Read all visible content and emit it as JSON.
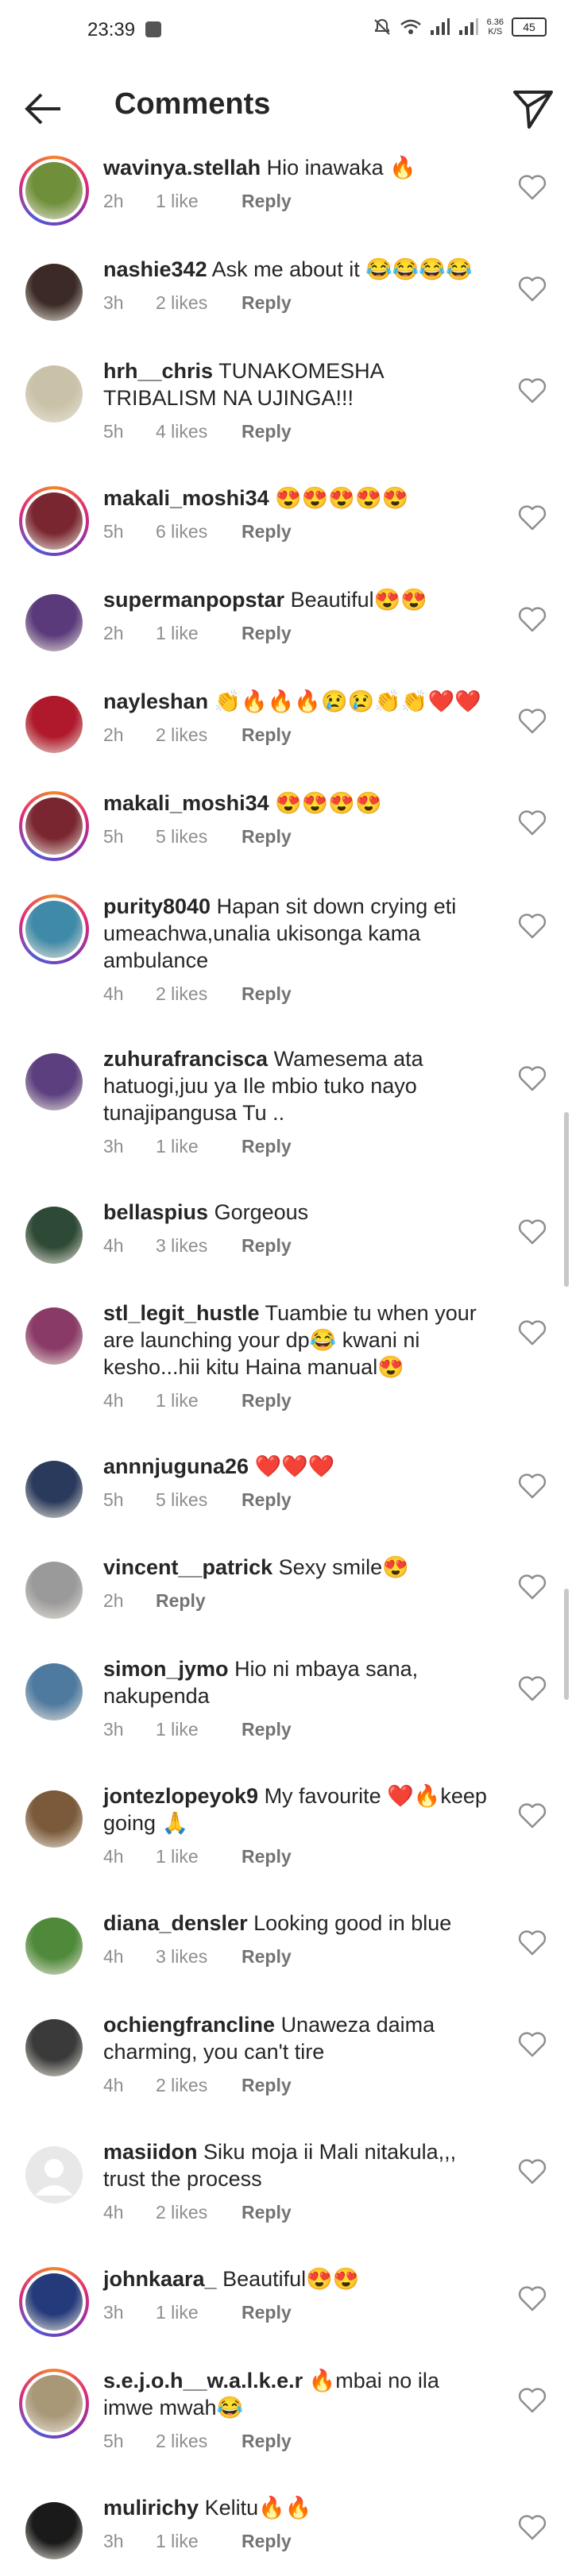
{
  "status": {
    "time": "23:39",
    "speed_top": "6.36",
    "speed_bottom": "K/S",
    "battery": "45"
  },
  "header": {
    "title": "Comments"
  },
  "colors": {
    "text": "#262626",
    "meta": "#8e8e8e",
    "accent_ring": "#dd2a7b"
  },
  "comments": [
    {
      "username": "wavinya.stellah",
      "text": "Hio inawaka 🔥",
      "age": "2h",
      "likes": "1 like",
      "reply": "Reply"
    },
    {
      "username": "nashie342",
      "text": "Ask me about it 😂😂😂😂",
      "age": "3h",
      "likes": "2 likes",
      "reply": "Reply"
    },
    {
      "username": "hrh__chris",
      "text": "TUNAKOMESHA TRIBALISM NA UJINGA!!!",
      "age": "5h",
      "likes": "4 likes",
      "reply": "Reply"
    },
    {
      "username": "makali_moshi34",
      "text": "😍😍😍😍😍",
      "age": "5h",
      "likes": "6 likes",
      "reply": "Reply"
    },
    {
      "username": "supermanpopstar",
      "text": "Beautiful😍😍",
      "age": "2h",
      "likes": "1 like",
      "reply": "Reply"
    },
    {
      "username": "nayleshan",
      "text": "👏🔥🔥🔥😢😢👏👏❤️❤️",
      "age": "2h",
      "likes": "2 likes",
      "reply": "Reply"
    },
    {
      "username": "makali_moshi34",
      "text": "😍😍😍😍",
      "age": "5h",
      "likes": "5 likes",
      "reply": "Reply"
    },
    {
      "username": "purity8040",
      "text": "Hapan sit down crying eti umeachwa,unalia ukisonga kama ambulance",
      "age": "4h",
      "likes": "2 likes",
      "reply": "Reply"
    },
    {
      "username": "zuhurafrancisca",
      "text": "Wamesema ata hatuogi,juu ya Ile mbio tuko nayo tunajipangusa Tu ..",
      "age": "3h",
      "likes": "1 like",
      "reply": "Reply"
    },
    {
      "username": "bellaspius",
      "text": "Gorgeous",
      "age": "4h",
      "likes": "3 likes",
      "reply": "Reply"
    },
    {
      "username": "stl_legit_hustle",
      "text": "Tuambie tu when your are launching your dp😂 kwani ni kesho...hii kitu Haina manual😍",
      "age": "4h",
      "likes": "1 like",
      "reply": "Reply"
    },
    {
      "username": "annnjuguna26",
      "text": "❤️❤️❤️",
      "age": "5h",
      "likes": "5 likes",
      "reply": "Reply"
    },
    {
      "username": "vincent__patrick",
      "text": "Sexy smile😍",
      "age": "2h",
      "likes": "",
      "reply": "Reply"
    },
    {
      "username": "simon_jymo",
      "text": "Hio ni mbaya sana, nakupenda",
      "age": "3h",
      "likes": "1 like",
      "reply": "Reply"
    },
    {
      "username": "jontezlopeyok9",
      "text": "My favourite ❤️🔥keep going 🙏",
      "age": "4h",
      "likes": "1 like",
      "reply": "Reply"
    },
    {
      "username": "diana_densler",
      "text": "Looking good in blue",
      "age": "4h",
      "likes": "3 likes",
      "reply": "Reply"
    },
    {
      "username": "ochiengfrancline",
      "text": "Unaweza daima charming, you can't tire",
      "age": "4h",
      "likes": "2 likes",
      "reply": "Reply"
    },
    {
      "username": "masiidon",
      "text": "Siku moja ii Mali nitakula,,, trust the process",
      "age": "4h",
      "likes": "2 likes",
      "reply": "Reply"
    },
    {
      "username": "johnkaara_",
      "text": "Beautiful😍😍",
      "age": "3h",
      "likes": "1 like",
      "reply": "Reply"
    },
    {
      "username": "s.e.j.o.h__w.a.l.k.e.r",
      "text": "🔥mbai no ila imwe mwah😂",
      "age": "5h",
      "likes": "2 likes",
      "reply": "Reply"
    },
    {
      "username": "mulirichy",
      "text": "Kelitu🔥🔥",
      "age": "3h",
      "likes": "1 like",
      "reply": "Reply"
    }
  ]
}
